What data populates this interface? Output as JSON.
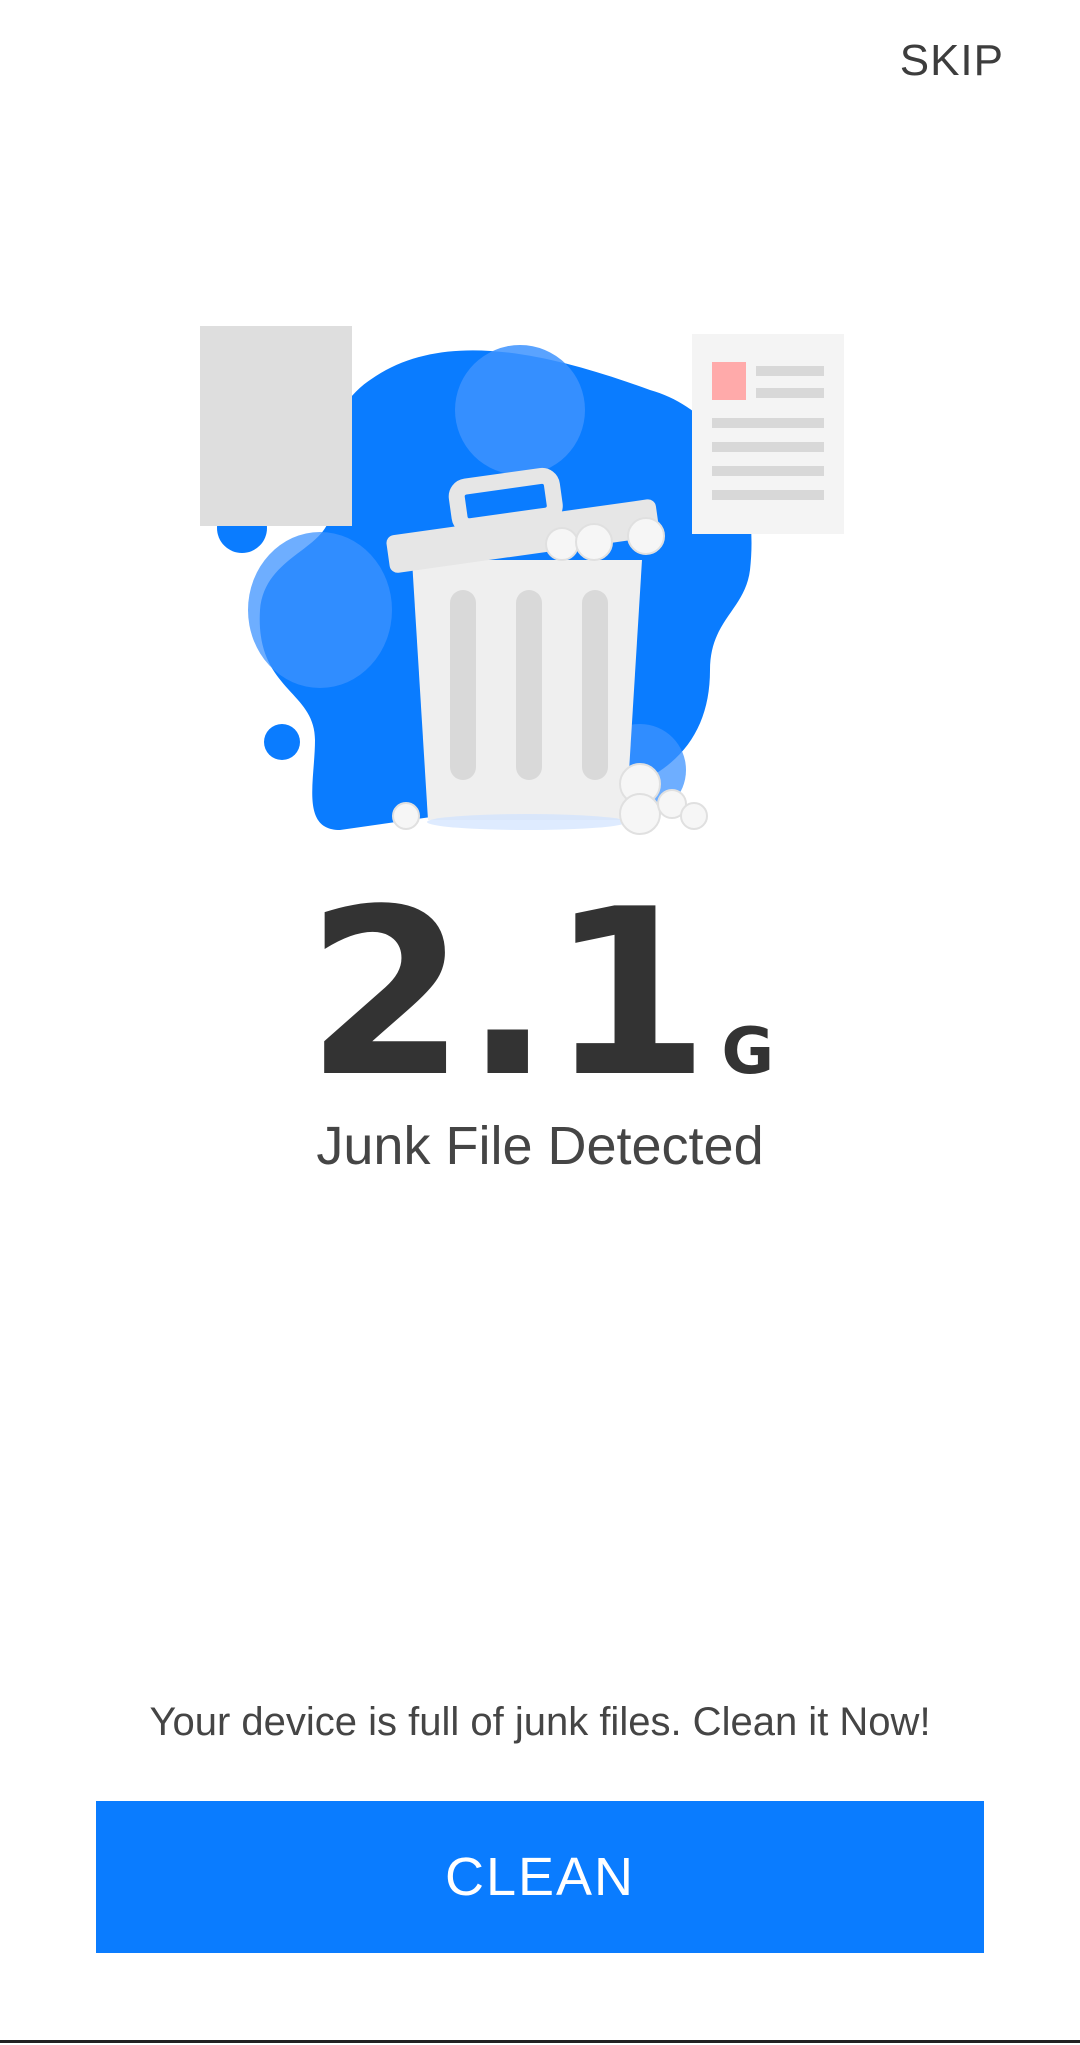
{
  "header": {
    "skip_label": "SKIP"
  },
  "illustration": {
    "icon": "trash-bin-icon",
    "accent_color": "#0a7cff"
  },
  "result": {
    "value": "2.1",
    "unit": "G",
    "label": "Junk File Detected"
  },
  "footer": {
    "message": "Your device is full of junk files. Clean it Now!",
    "clean_label": "CLEAN"
  },
  "colors": {
    "primary": "#0a7cff",
    "text": "#333333"
  }
}
